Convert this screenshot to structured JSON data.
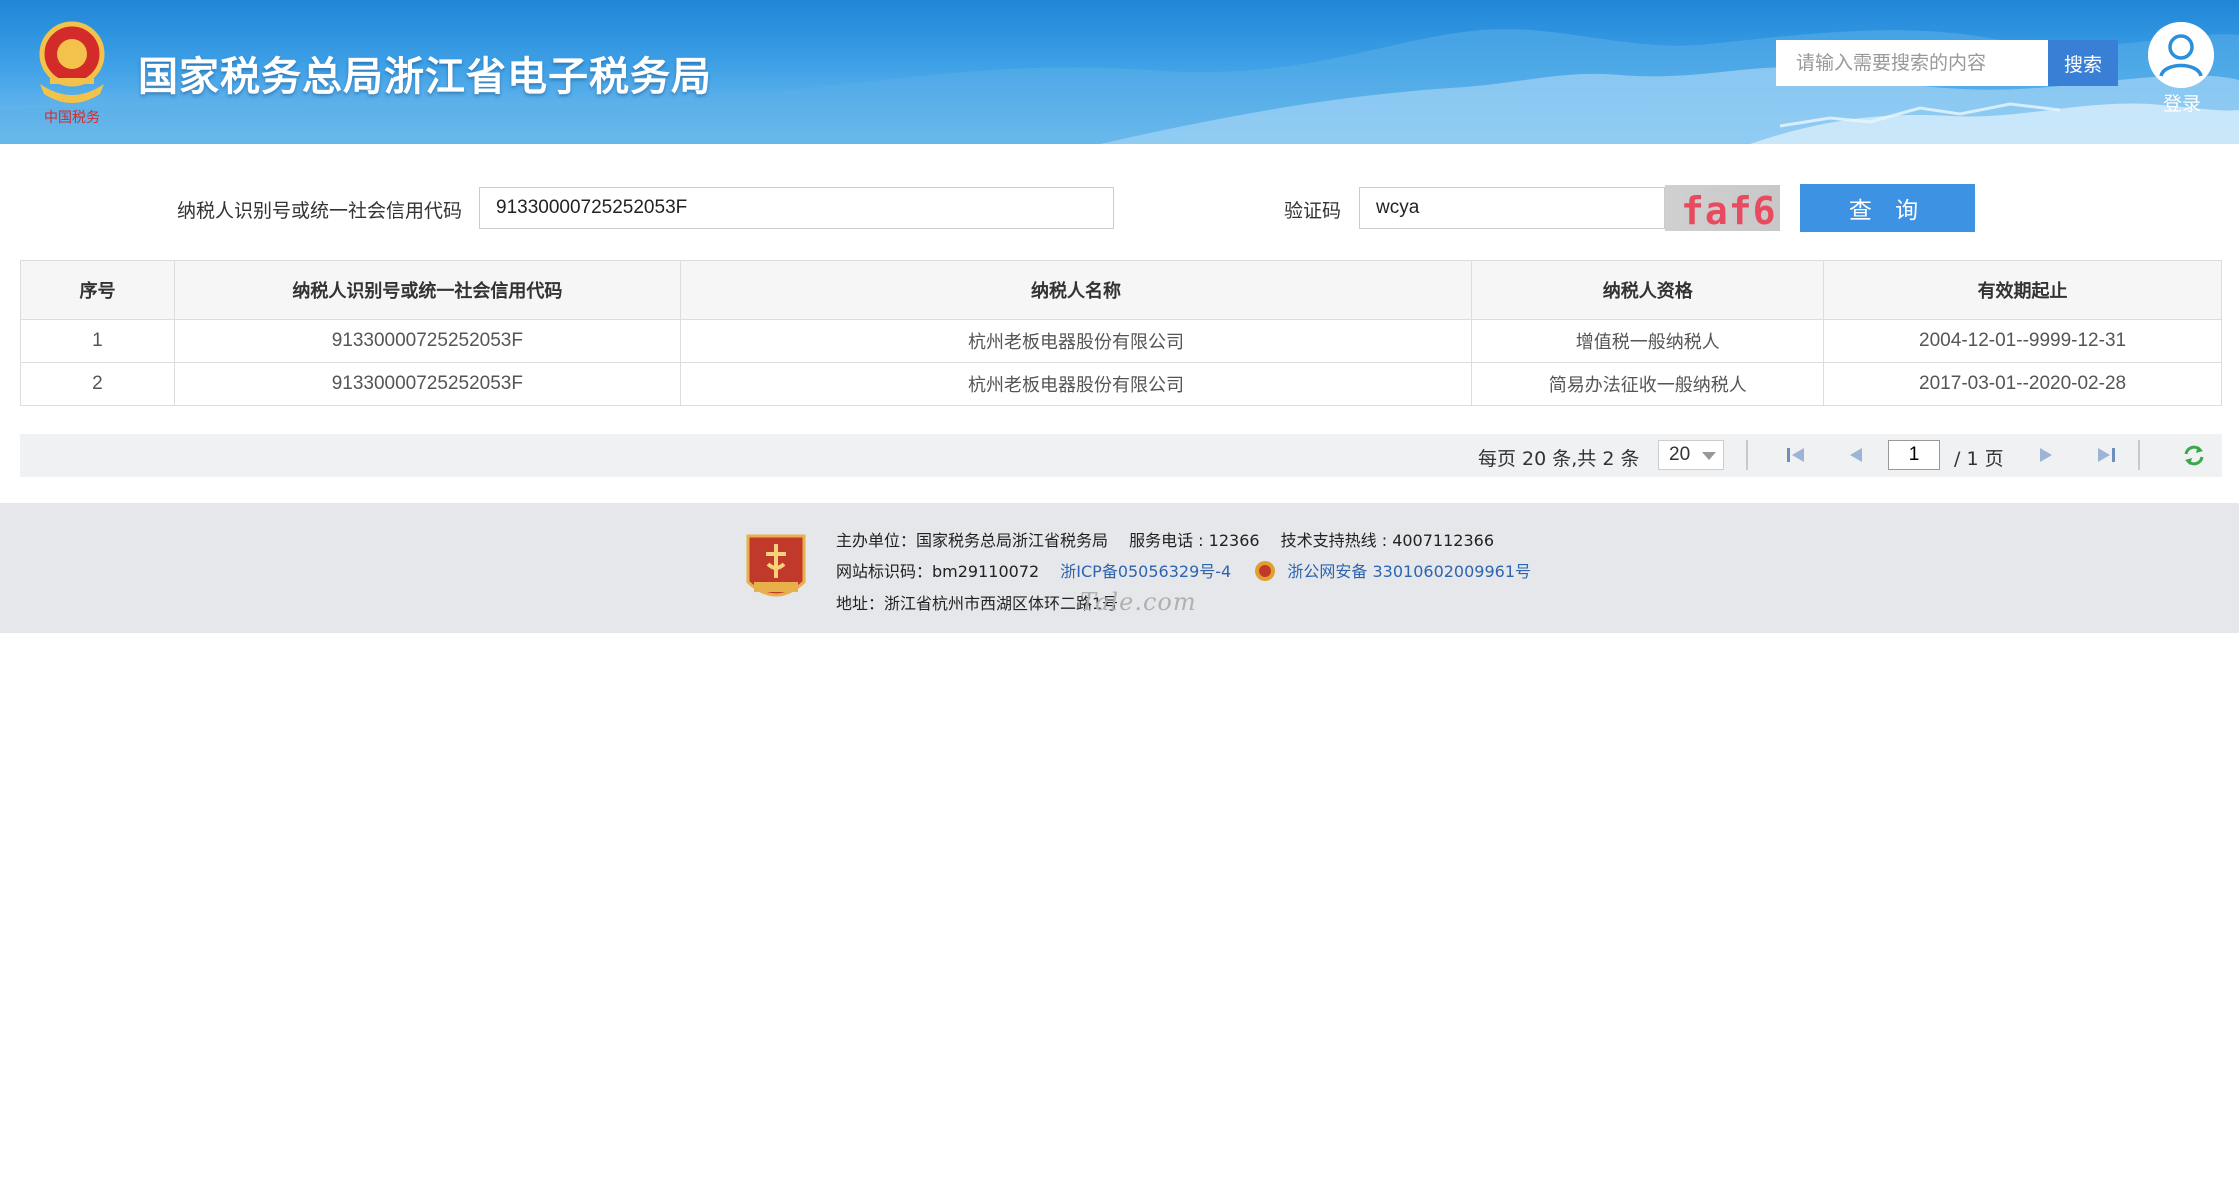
{
  "header": {
    "site_title": "国家税务总局浙江省电子税务局",
    "search_placeholder": "请输入需要搜索的内容",
    "search_button": "搜索",
    "login_label": "登录"
  },
  "query_form": {
    "taxpayer_id_label": "纳税人识别号或统一社会信用代码",
    "taxpayer_id_value": "91330000725252053F",
    "captcha_label": "验证码",
    "captcha_value": "wcya",
    "captcha_image_text": "faf6",
    "query_button": "查 询"
  },
  "table": {
    "columns": [
      "序号",
      "纳税人识别号或统一社会信用代码",
      "纳税人名称",
      "纳税人资格",
      "有效期起止"
    ],
    "rows": [
      [
        "1",
        "91330000725252053F",
        "杭州老板电器股份有限公司",
        "增值税一般纳税人",
        "2004-12-01--9999-12-31"
      ],
      [
        "2",
        "91330000725252053F",
        "杭州老板电器股份有限公司",
        "简易办法征收一般纳税人",
        "2017-03-01--2020-02-28"
      ]
    ]
  },
  "pagination": {
    "summary": "每页 20 条,共 2 条",
    "page_size": "20",
    "current_page": "1",
    "total_pages": "/ 1 页"
  },
  "footer": {
    "line1": "主办单位：国家税务总局浙江省税务局　 服务电话 : 12366　 技术支持热线 : 4007112366",
    "site_code": "网站标识码：bm29110072",
    "icp": "浙ICP备05056329号-4",
    "police": "浙公网安备 33010602009961号",
    "address": "地址：浙江省杭州市西湖区体环二路1号",
    "watermark": "Tale.com"
  },
  "colors": {
    "header_blue": "#2a8fdd",
    "query_button": "#3e92e4",
    "link_blue": "#2d64b0",
    "footer_bg": "#e6e7ea"
  }
}
